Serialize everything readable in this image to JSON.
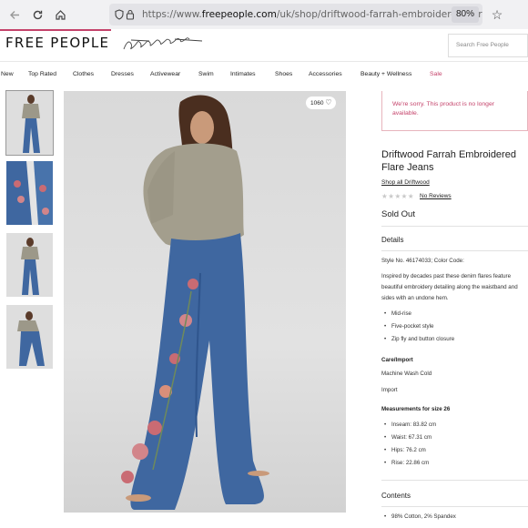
{
  "browser": {
    "url_prefix": "https://www.",
    "url_domain": "freepeople.com",
    "url_path": "/uk/shop/driftwood-farrah-embroidered-flare",
    "zoom": "80%"
  },
  "header": {
    "logo": "FREE PEOPLE",
    "search_placeholder": "Search Free People"
  },
  "nav": {
    "items": [
      "New",
      "Top Rated",
      "Clothes",
      "Dresses",
      "Activewear",
      "Swim",
      "Intimates",
      "Shoes",
      "Accessories",
      "Beauty + Wellness"
    ],
    "sale": "Sale"
  },
  "gallery": {
    "like_count": "1060"
  },
  "product": {
    "error": "We're sorry. This product is no longer available.",
    "title": "Driftwood Farrah Embroidered Flare Jeans",
    "shop_all": "Shop all Driftwood",
    "stars": "★★★★★",
    "reviews": "No Reviews",
    "status": "Sold Out",
    "details_heading": "Details",
    "style_no": "Style No. 46174033; Color Code:",
    "description": "Inspired by decades past these denim flares feature beautiful embroidery detailing along the waistband and sides with an undone hem.",
    "features": [
      "Mid-rise",
      "Five-pocket style",
      "Zip fly and button closure"
    ],
    "care_heading": "Care/Import",
    "care": "Machine Wash Cold",
    "import": "Import",
    "measurements_heading": "Measurements for size 26",
    "measurements": [
      "Inseam: 83.82 cm",
      "Waist: 67.31 cm",
      "Hips: 76.2 cm",
      "Rise: 22.86 cm"
    ],
    "contents_heading": "Contents",
    "contents": [
      "98% Cotton, 2% Spandex"
    ]
  },
  "colors": {
    "accent": "#c4426a",
    "denim": "#3f67a0"
  }
}
